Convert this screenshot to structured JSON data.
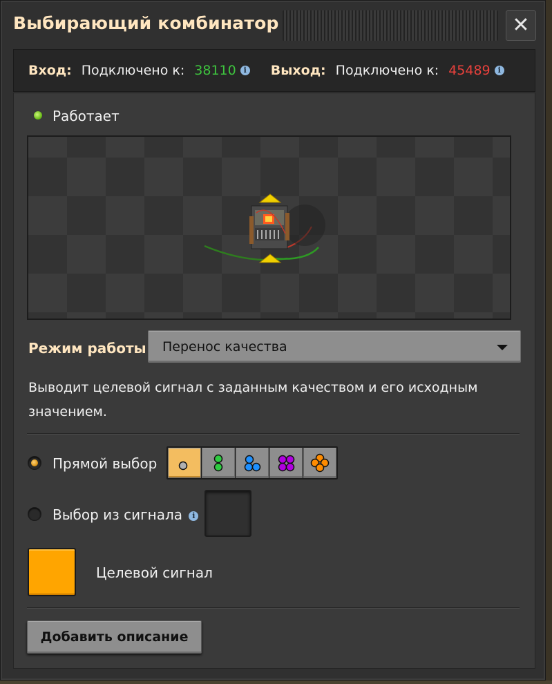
{
  "window": {
    "title": "Выбирающий комбинатор",
    "close_symbol": "✕"
  },
  "connections": {
    "input_label": "Вход:",
    "input_text": "Подключено к:",
    "input_value": "38110",
    "input_value_color": "#3ec43e",
    "output_label": "Выход:",
    "output_text": "Подключено к:",
    "output_value": "45489",
    "output_value_color": "#e8413c",
    "info_glyph": "i"
  },
  "status": {
    "text": "Работает",
    "color": "#7ed321"
  },
  "operation_mode": {
    "label": "Режим работы",
    "selected": "Перенос качества"
  },
  "description": "Выводит целевой сигнал с заданным качеством и его исходным значением.",
  "quality_selection": {
    "direct_label": "Прямой выбор",
    "direct_checked": true,
    "signal_label": "Выбор из сигнала",
    "signal_checked": false,
    "qualities": [
      {
        "icon": "normal-quality-icon",
        "color": "#b0b0b0",
        "selected": true
      },
      {
        "icon": "uncommon-quality-icon",
        "color": "#2ecc40",
        "selected": false
      },
      {
        "icon": "rare-quality-icon",
        "color": "#1e90ff",
        "selected": false
      },
      {
        "icon": "epic-quality-icon",
        "color": "#b000e0",
        "selected": false
      },
      {
        "icon": "legendary-quality-icon",
        "color": "#ff8c00",
        "selected": false
      }
    ]
  },
  "target_signal": {
    "label": "Целевой сигнал",
    "color": "#ffa500"
  },
  "buttons": {
    "add_description": "Добавить описание"
  }
}
